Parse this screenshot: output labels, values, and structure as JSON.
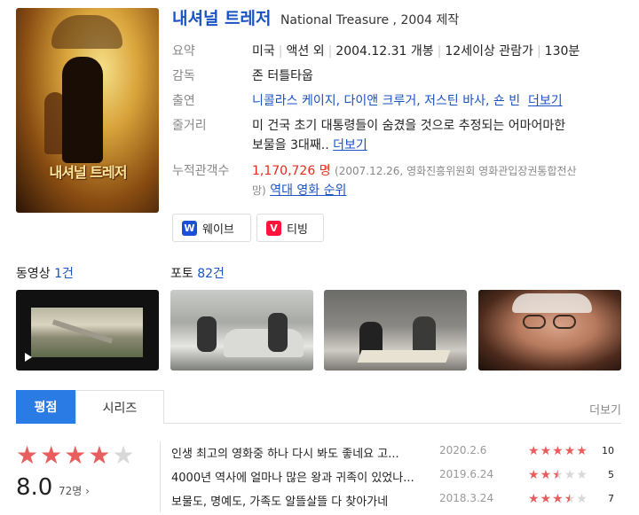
{
  "movie": {
    "title": "내셔널 트레저",
    "subtitle": "National Treasure , 2004 제작",
    "poster_title": "내셔널 트레저"
  },
  "info": {
    "summary_label": "요약",
    "summary": [
      "미국",
      "액션 외",
      "2004.12.31 개봉",
      "12세이상 관람가",
      "130분"
    ],
    "director_label": "감독",
    "director": "존 터틀타웁",
    "cast_label": "출연",
    "cast": "니콜라스 케이지, 다이앤 크루거, 저스틴 바사, 숀 빈",
    "cast_more": "더보기",
    "plot_label": "줄거리",
    "plot_line1": "미 건국 초기 대통령들이 숨겼을 것으로 추정되는 어마어마한",
    "plot_line2": "보물을 3대째..",
    "plot_more": "더보기",
    "audience_label": "누적관객수",
    "audience_value": "1,170,726 명",
    "audience_note1": "(2007.12.26, 영화진흥위원회 영화관입장권통합전산",
    "audience_note2": "망)",
    "audience_rank": "역대 영화 순위"
  },
  "ott": [
    {
      "label": "웨이브",
      "badge": "W",
      "color": "#1a4fd6"
    },
    {
      "label": "티빙",
      "badge": "V",
      "color": "#ff153c"
    }
  ],
  "media": {
    "video_label": "동영상",
    "video_count": "1건",
    "photo_label": "포토",
    "photo_count": "82건"
  },
  "tabs": {
    "rating": "평점",
    "series": "시리즈",
    "more": "더보기"
  },
  "rating": {
    "score": "8.0",
    "count": "72명",
    "stars": 4
  },
  "reviews": [
    {
      "text": "인생 최고의 영화중 하나 다시 봐도 좋네요 고...",
      "date": "2020.2.6",
      "score": "10",
      "stars": 5
    },
    {
      "text": "4000년 역사에 얼마나 많은 왕과 귀족이 있었나...",
      "date": "2019.6.24",
      "score": "5",
      "stars": 2.5
    },
    {
      "text": "보물도, 명예도, 가족도 알뜰살뜰 다 찾아가네",
      "date": "2018.3.24",
      "score": "7",
      "stars": 3.5
    }
  ]
}
